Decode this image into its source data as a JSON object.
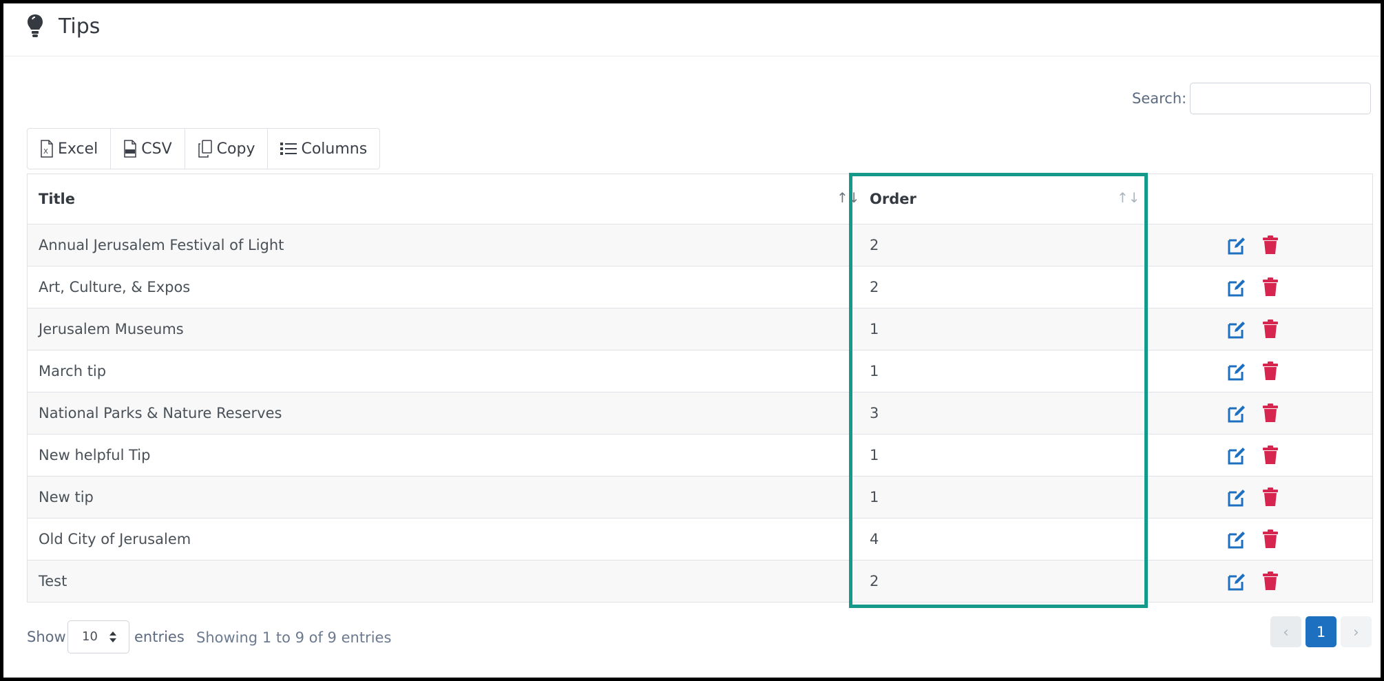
{
  "header": {
    "title": "Tips",
    "icon": "lightbulb-icon"
  },
  "search": {
    "label": "Search:",
    "value": "",
    "placeholder": ""
  },
  "toolbar": {
    "excel_label": "Excel",
    "csv_label": "CSV",
    "copy_label": "Copy",
    "columns_label": "Columns"
  },
  "table": {
    "columns": [
      "Title",
      "Order"
    ],
    "rows": [
      {
        "title": "Annual Jerusalem Festival of Light",
        "order": "2"
      },
      {
        "title": "Art, Culture, & Expos",
        "order": "2"
      },
      {
        "title": "Jerusalem Museums",
        "order": "1"
      },
      {
        "title": "March tip",
        "order": "1"
      },
      {
        "title": "National Parks & Nature Reserves",
        "order": "3"
      },
      {
        "title": "New helpful Tip",
        "order": "1"
      },
      {
        "title": "New tip",
        "order": "1"
      },
      {
        "title": "Old City of Jerusalem",
        "order": "4"
      },
      {
        "title": "Test",
        "order": "2"
      }
    ]
  },
  "footer": {
    "show_label": "Show",
    "page_length": "10",
    "entries_label": "entries",
    "info": "Showing 1 to 9 of 9 entries",
    "prev": "‹",
    "current_page": "1",
    "next": "›"
  },
  "colors": {
    "highlight": "#14998b",
    "edit": "#1d6fc0",
    "delete": "#d6264f",
    "page_active": "#1d6fc0"
  }
}
